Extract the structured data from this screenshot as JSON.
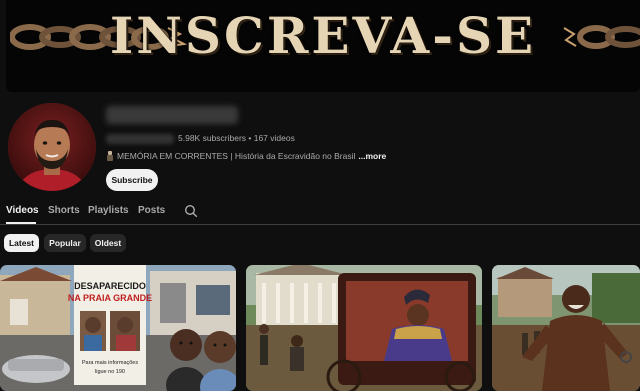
{
  "banner": {
    "title": "INSCREVA-SE"
  },
  "channel": {
    "stats": "5.98K subscribers • 167 videos",
    "description": "MEMÓRIA EM CORRENTES | História da Escravidão no Brasil",
    "more_label": "...more",
    "subscribe_label": "Subscribe"
  },
  "tabs": [
    {
      "label": "Videos"
    },
    {
      "label": "Shorts"
    },
    {
      "label": "Playlists"
    },
    {
      "label": "Posts"
    }
  ],
  "chips": [
    {
      "label": "Latest"
    },
    {
      "label": "Popular"
    },
    {
      "label": "Oldest"
    }
  ],
  "videos": [
    {
      "poster_line1": "DESAPARECIDO",
      "poster_line2": "NA PRAIA GRANDE",
      "poster_small1": "Para mais informações",
      "poster_small2": "ligue no 190"
    },
    {},
    {}
  ]
}
